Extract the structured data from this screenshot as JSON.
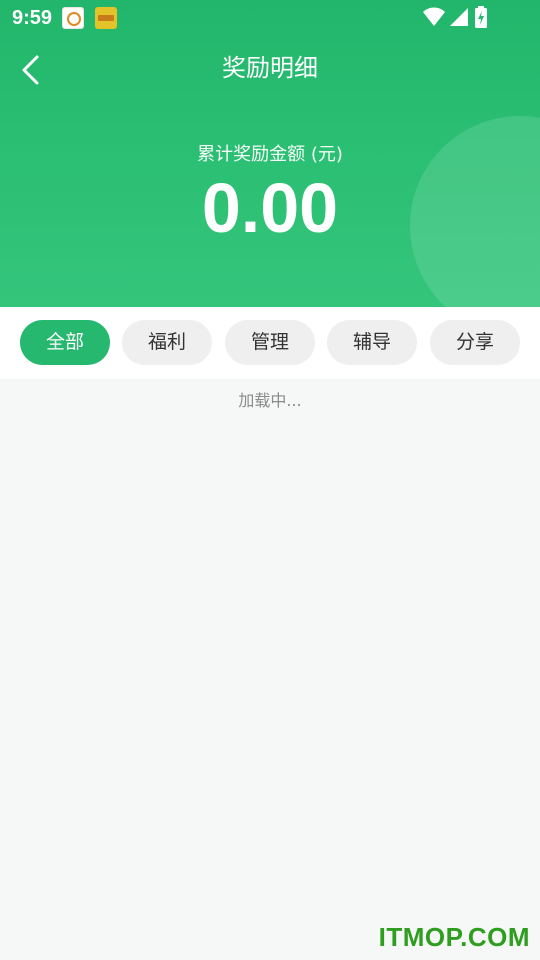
{
  "status_bar": {
    "time": "9:59",
    "notification_icons": [
      "app-notification-icon",
      "app-notification-icon"
    ],
    "system_icons": [
      "wifi-icon",
      "cellular-signal-icon",
      "battery-charging-icon"
    ]
  },
  "header": {
    "title": "奖励明细",
    "back_icon": "chevron-left-icon"
  },
  "summary": {
    "label": "累计奖励金额 (元)",
    "value": "0.00"
  },
  "filters": {
    "tabs": [
      {
        "label": "全部",
        "active": true
      },
      {
        "label": "福利",
        "active": false
      },
      {
        "label": "管理",
        "active": false
      },
      {
        "label": "辅导",
        "active": false
      },
      {
        "label": "分享",
        "active": false
      }
    ]
  },
  "content": {
    "loading_text": "加载中..."
  },
  "watermark": {
    "text": "ITMOP.COM"
  },
  "colors": {
    "primary_green": "#27b86f",
    "header_gradient_top": "#22b66c",
    "header_gradient_bottom": "#34c57b",
    "chip_inactive_bg": "#efefef",
    "page_bg": "#f5f8f7",
    "watermark": "#2f9d1f"
  }
}
